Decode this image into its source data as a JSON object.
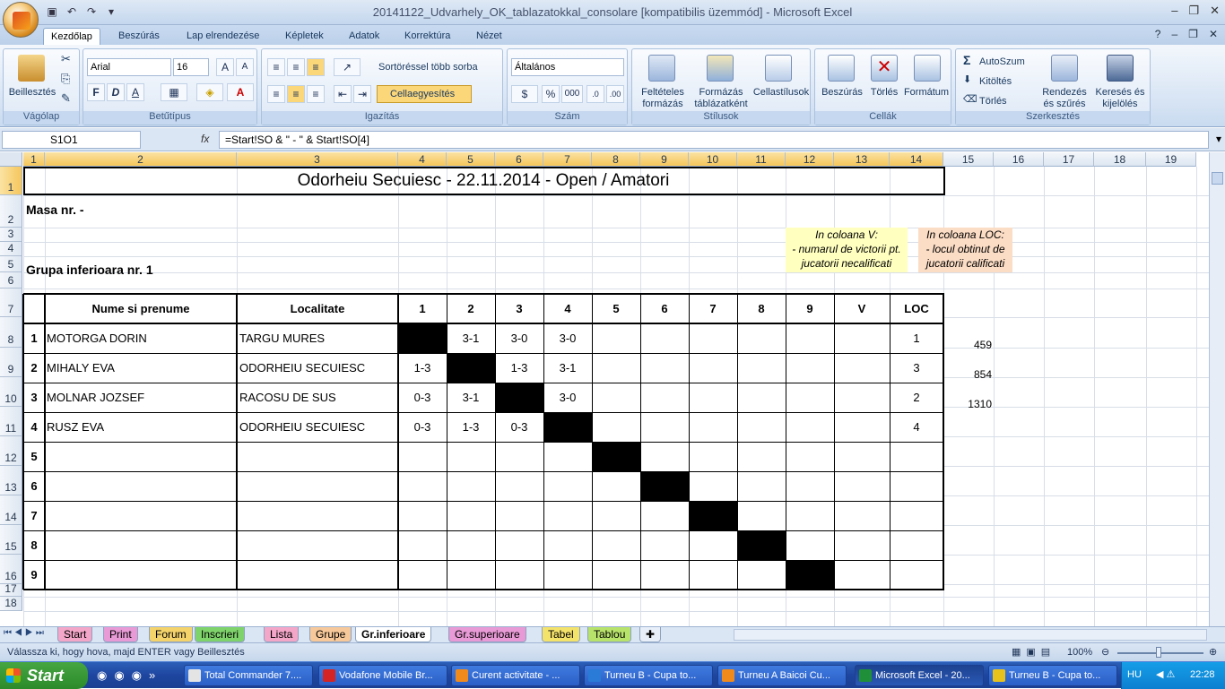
{
  "window": {
    "title": "20141122_Udvarhely_OK_tablazatokkal_consolare  [kompatibilis üzemmód] - Microsoft Excel"
  },
  "ribbon": {
    "tabs": [
      "Kezdőlap",
      "Beszúrás",
      "Lap elrendezése",
      "Képletek",
      "Adatok",
      "Korrektúra",
      "Nézet"
    ],
    "groups": {
      "clipboard": {
        "title": "Vágólap",
        "paste": "Beillesztés"
      },
      "font": {
        "title": "Betűtípus",
        "font_name": "Arial",
        "font_size": "16",
        "bold": "F",
        "italic": "D",
        "underline": "A"
      },
      "alignment": {
        "title": "Igazítás",
        "wrap": "Sortöréssel több sorba",
        "merge": "Cellaegyesítés"
      },
      "number": {
        "title": "Szám",
        "format": "Általános",
        "percent": "%",
        "thousands": "000"
      },
      "styles": {
        "title": "Stílusok",
        "cond": "Feltételes formázás",
        "table": "Formázás táblázatként",
        "cellstyles": "Cellastílusok"
      },
      "cells": {
        "title": "Cellák",
        "insert": "Beszúrás",
        "delete": "Törlés",
        "format": "Formátum"
      },
      "editing": {
        "title": "Szerkesztés",
        "autosum": "AutoSzum",
        "fill": "Kitöltés",
        "clear": "Törlés",
        "sort": "Rendezés és szűrés",
        "find": "Keresés és kijelölés"
      }
    }
  },
  "formula_bar": {
    "name_box": "S1O1",
    "fx": "fx",
    "formula": "=Start!SO & \" - \" & Start!SO[4]"
  },
  "grid": {
    "col_headers": [
      "1",
      "2",
      "3",
      "4",
      "5",
      "6",
      "7",
      "8",
      "9",
      "10",
      "11",
      "12",
      "13",
      "14",
      "15",
      "16",
      "17",
      "18",
      "19"
    ],
    "row_headers": [
      "1",
      "2",
      "3",
      "4",
      "5",
      "6",
      "7",
      "8",
      "9",
      "10",
      "11",
      "12",
      "13",
      "14",
      "15",
      "16",
      "17",
      "18"
    ],
    "title": "Odorheiu Secuiesc - 22.11.2014 - Open / Amatori",
    "masa": "Masa nr.  -",
    "grupa": "Grupa inferioara nr. 1",
    "note_v": [
      "In coloana V:",
      "- numarul de victorii pt.",
      "jucatorii necalificati"
    ],
    "note_loc": [
      "In coloana LOC:",
      "- locul obtinut de",
      "jucatorii calificati"
    ],
    "table_headers": {
      "name": "Nume si prenume",
      "loc_label": "Localitate",
      "cols": [
        "1",
        "2",
        "3",
        "4",
        "5",
        "6",
        "7",
        "8",
        "9",
        "V",
        "LOC"
      ]
    },
    "players": [
      {
        "nr": "1",
        "name": "MOTORGA DORIN",
        "city": "TARGU MURES",
        "scores": [
          "",
          "3-1",
          "3-0",
          "3-0",
          "",
          "",
          "",
          "",
          ""
        ],
        "v": "",
        "loc": "1",
        "extra": "459"
      },
      {
        "nr": "2",
        "name": "MIHALY EVA",
        "city": "ODORHEIU SECUIESC",
        "scores": [
          "1-3",
          "",
          "1-3",
          "3-1",
          "",
          "",
          "",
          "",
          ""
        ],
        "v": "",
        "loc": "3",
        "extra": "854"
      },
      {
        "nr": "3",
        "name": "MOLNAR JOZSEF",
        "city": "RACOSU DE SUS",
        "scores": [
          "0-3",
          "3-1",
          "",
          "3-0",
          "",
          "",
          "",
          "",
          ""
        ],
        "v": "",
        "loc": "2",
        "extra": "1310"
      },
      {
        "nr": "4",
        "name": "RUSZ EVA",
        "city": "ODORHEIU SECUIESC",
        "scores": [
          "0-3",
          "1-3",
          "0-3",
          "",
          "",
          "",
          "",
          "",
          ""
        ],
        "v": "",
        "loc": "4",
        "extra": ""
      },
      {
        "nr": "5",
        "name": "",
        "city": "",
        "scores": [
          "",
          "",
          "",
          "",
          "",
          "",
          "",
          "",
          ""
        ],
        "v": "",
        "loc": "",
        "extra": ""
      },
      {
        "nr": "6",
        "name": "",
        "city": "",
        "scores": [
          "",
          "",
          "",
          "",
          "",
          "",
          "",
          "",
          ""
        ],
        "v": "",
        "loc": "",
        "extra": ""
      },
      {
        "nr": "7",
        "name": "",
        "city": "",
        "scores": [
          "",
          "",
          "",
          "",
          "",
          "",
          "",
          "",
          ""
        ],
        "v": "",
        "loc": "",
        "extra": ""
      },
      {
        "nr": "8",
        "name": "",
        "city": "",
        "scores": [
          "",
          "",
          "",
          "",
          "",
          "",
          "",
          "",
          ""
        ],
        "v": "",
        "loc": "",
        "extra": ""
      },
      {
        "nr": "9",
        "name": "",
        "city": "",
        "scores": [
          "",
          "",
          "",
          "",
          "",
          "",
          "",
          "",
          ""
        ],
        "v": "",
        "loc": "",
        "extra": ""
      }
    ]
  },
  "sheet_tabs": [
    {
      "label": "Start",
      "color": "#f4a6c8"
    },
    {
      "label": "Print",
      "color": "#e89ad6"
    },
    {
      "label": "Forum",
      "color": "#f4d36b"
    },
    {
      "label": "Inscrieri",
      "color": "#7fd36b"
    },
    {
      "label": "Lista",
      "color": "#f4a6c8"
    },
    {
      "label": "Grupe",
      "color": "#f7c99a"
    },
    {
      "label": "Gr.inferioare",
      "color": "#ffffff"
    },
    {
      "label": "Gr.superioare",
      "color": "#e89ad6"
    },
    {
      "label": "Tabel",
      "color": "#f4e36b"
    },
    {
      "label": "Tablou",
      "color": "#b8e36b"
    }
  ],
  "status": {
    "text": "Válassza ki, hogy hova, majd ENTER vagy Beillesztés",
    "zoom": "100%"
  },
  "taskbar": {
    "start": "Start",
    "tasks": [
      "Total Commander 7....",
      "Vodafone Mobile Br...",
      "Curent activitate - ...",
      "Turneu B - Cupa to...",
      "Turneu A Baicoi Cu...",
      "Microsoft Excel - 20...",
      "Turneu B - Cupa to..."
    ],
    "lang": "HU",
    "clock": "22:28"
  }
}
